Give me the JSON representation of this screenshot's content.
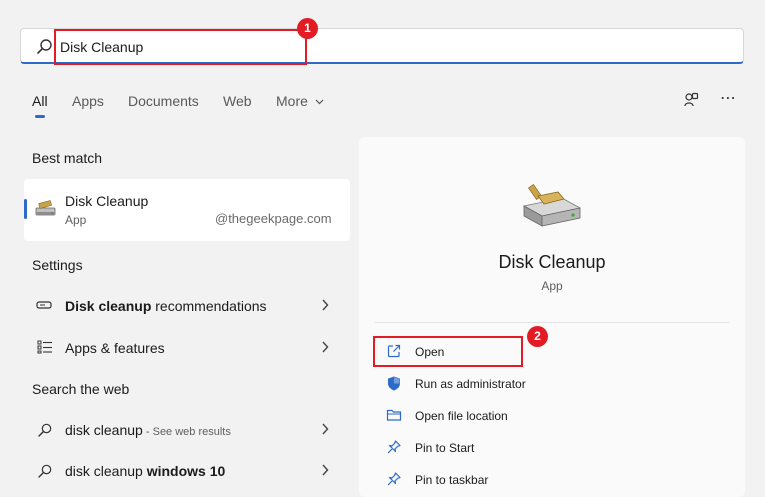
{
  "search": {
    "value": "Disk Cleanup",
    "placeholder": ""
  },
  "annotations": {
    "badge1": "1",
    "badge2": "2"
  },
  "tabs": [
    {
      "label": "All",
      "active": true
    },
    {
      "label": "Apps"
    },
    {
      "label": "Documents"
    },
    {
      "label": "Web"
    },
    {
      "label": "More"
    }
  ],
  "best_match": {
    "heading": "Best match",
    "title": "Disk Cleanup",
    "subtitle": "App"
  },
  "watermark": "@thegeekpage.com",
  "settings": {
    "heading": "Settings",
    "items": [
      {
        "bold": "Disk cleanup",
        "rest": " recommendations"
      },
      {
        "bold": "",
        "rest": "Apps & features"
      }
    ]
  },
  "web": {
    "heading": "Search the web",
    "items": [
      {
        "main": "disk cleanup",
        "extra": " - See web results",
        "bold": ""
      },
      {
        "main": "disk cleanup ",
        "extra": "",
        "bold": "windows 10"
      }
    ]
  },
  "detail": {
    "title": "Disk Cleanup",
    "subtitle": "App",
    "actions": [
      {
        "label": "Open",
        "icon": "open-icon"
      },
      {
        "label": "Run as administrator",
        "icon": "shield-icon"
      },
      {
        "label": "Open file location",
        "icon": "folder-icon"
      },
      {
        "label": "Pin to Start",
        "icon": "pin-icon"
      },
      {
        "label": "Pin to taskbar",
        "icon": "pin-icon"
      }
    ]
  },
  "colors": {
    "accent": "#2d6ac9",
    "annotation": "#e21b25"
  }
}
